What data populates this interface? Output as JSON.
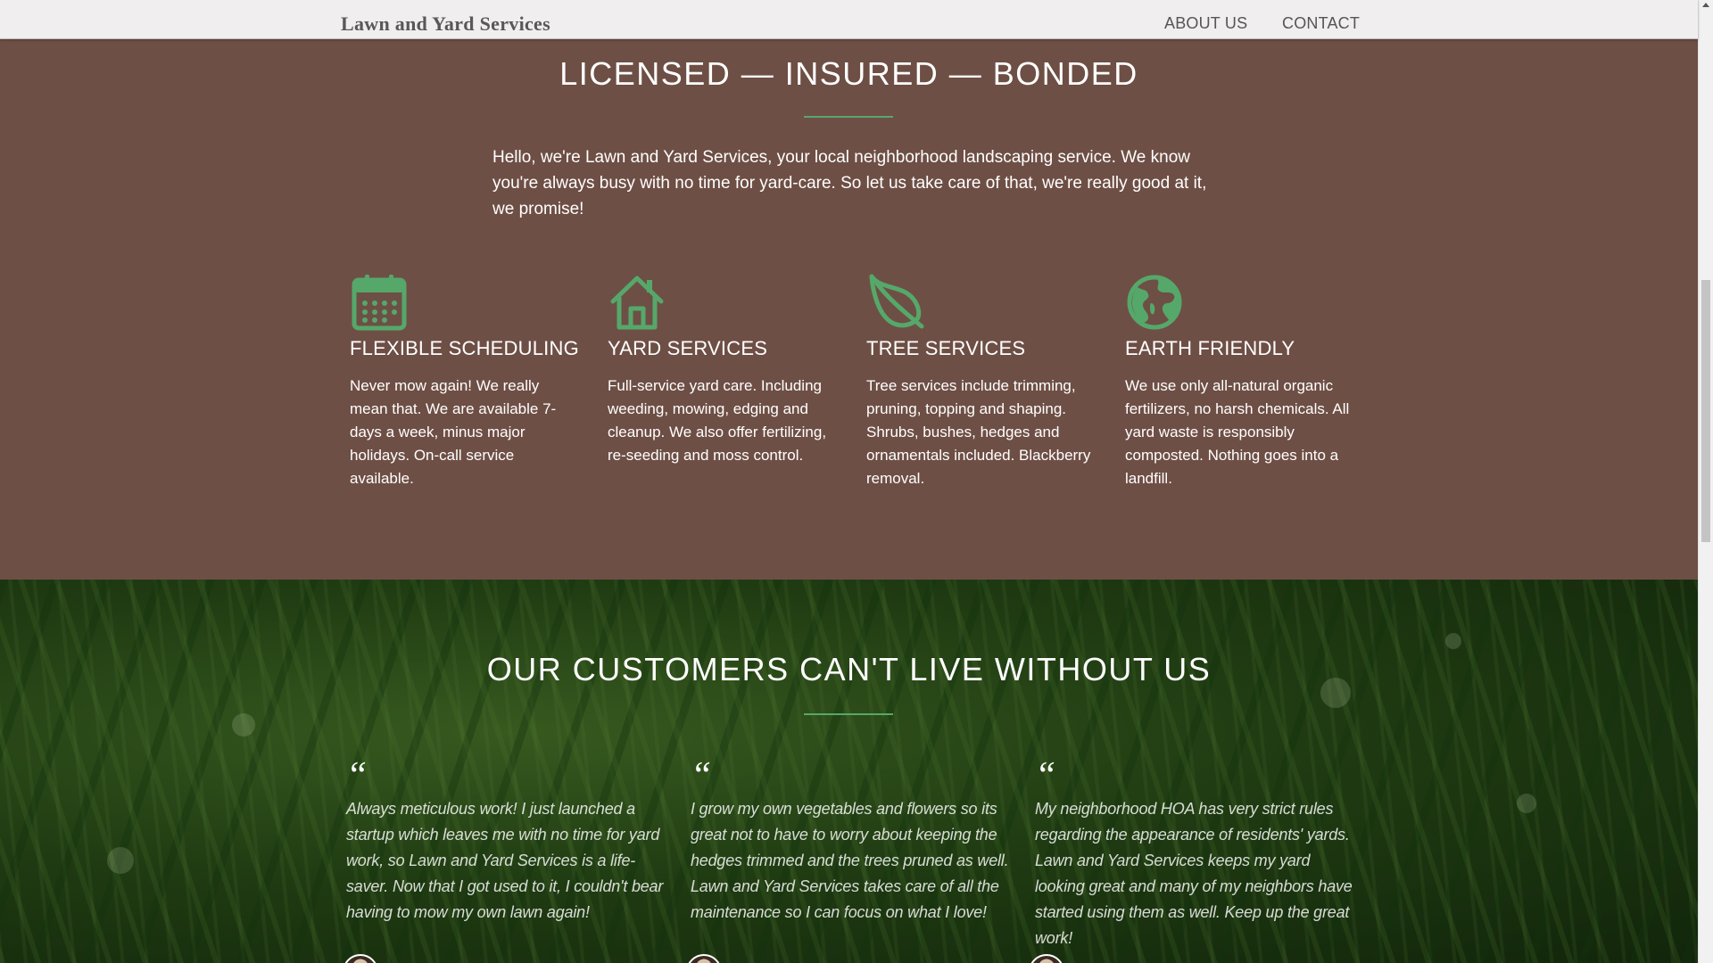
{
  "navbar": {
    "brand": "Lawn and Yard Services",
    "links": [
      "ABOUT US",
      "CONTACT"
    ]
  },
  "about": {
    "title": "LICENSED — INSURED — BONDED",
    "intro": "Hello, we're Lawn and Yard Services, your local neighborhood landscaping service. We know you're always busy with no time for yard-care. So let us take care of that, we're really good at it, we promise!",
    "features": [
      {
        "icon": "calendar-icon",
        "title": "FLEXIBLE SCHEDULING",
        "text": "Never mow again! We really mean that. We are available 7-days a week, minus major holidays. On-call service available."
      },
      {
        "icon": "house-icon",
        "title": "YARD SERVICES",
        "text": "Full-service yard care. Including weeding, mowing, edging and cleanup. We also offer fertilizing, re-seeding and moss control."
      },
      {
        "icon": "leaf-icon",
        "title": "TREE SERVICES",
        "text": "Tree services include trimming, pruning, topping and shaping. Shrubs, bushes, hedges and ornamentals included. Blackberry removal."
      },
      {
        "icon": "globe-icon",
        "title": "EARTH FRIENDLY",
        "text": "We use only all-natural organic fertilizers, no harsh chemicals. All yard waste is responsibly composted. Nothing goes into a landfill."
      }
    ]
  },
  "testimonials": {
    "title": "OUR CUSTOMERS CAN'T LIVE WITHOUT US",
    "quote_mark": "“",
    "quotes": [
      "Always meticulous work! I just launched a startup which leaves me with no time for yard work, so Lawn and Yard Services is a life-saver. Now that I got used to it, I couldn't bear having to mow my own lawn again!",
      "I grow my own vegetables and flowers so its great not to have to worry about keeping the hedges trimmed and the trees pruned as well. Lawn and Yard Services takes care of all the maintenance so I can focus on what I love!",
      "My neighborhood HOA has very strict rules regarding the appearance of residents' yards. Lawn and Yard Services keeps my yard looking great and many of my neighbors have started using them as well. Keep up the great work!"
    ]
  },
  "colors": {
    "brown_bg": "#6e4f45",
    "accent_green": "#55a86a",
    "nav_bg": "#f0eeee"
  }
}
